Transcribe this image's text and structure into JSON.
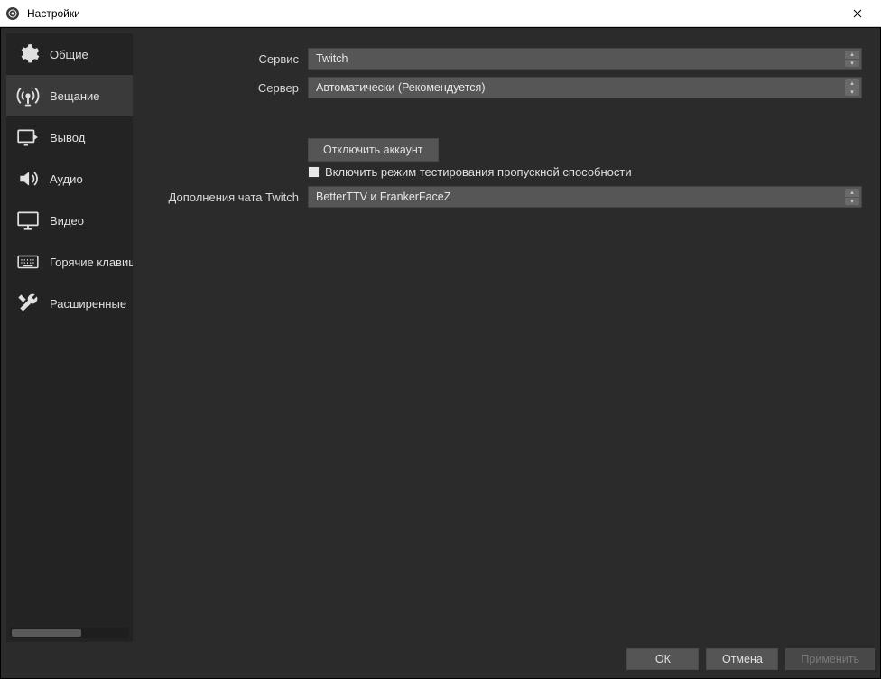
{
  "window": {
    "title": "Настройки"
  },
  "sidebar": {
    "items": [
      {
        "label": "Общие"
      },
      {
        "label": "Вещание"
      },
      {
        "label": "Вывод"
      },
      {
        "label": "Аудио"
      },
      {
        "label": "Видео"
      },
      {
        "label": "Горячие клавиши"
      },
      {
        "label": "Расширенные"
      }
    ],
    "active_index": 1
  },
  "form": {
    "service_label": "Сервис",
    "service_value": "Twitch",
    "server_label": "Сервер",
    "server_value": "Автоматически (Рекомендуется)",
    "disconnect_button": "Отключить аккаунт",
    "bandwidth_test_label": "Включить режим тестирования пропускной способности",
    "addons_label": "Дополнения чата Twitch",
    "addons_value": "BetterTTV и FrankerFaceZ"
  },
  "footer": {
    "ok": "ОК",
    "cancel": "Отмена",
    "apply": "Применить"
  }
}
